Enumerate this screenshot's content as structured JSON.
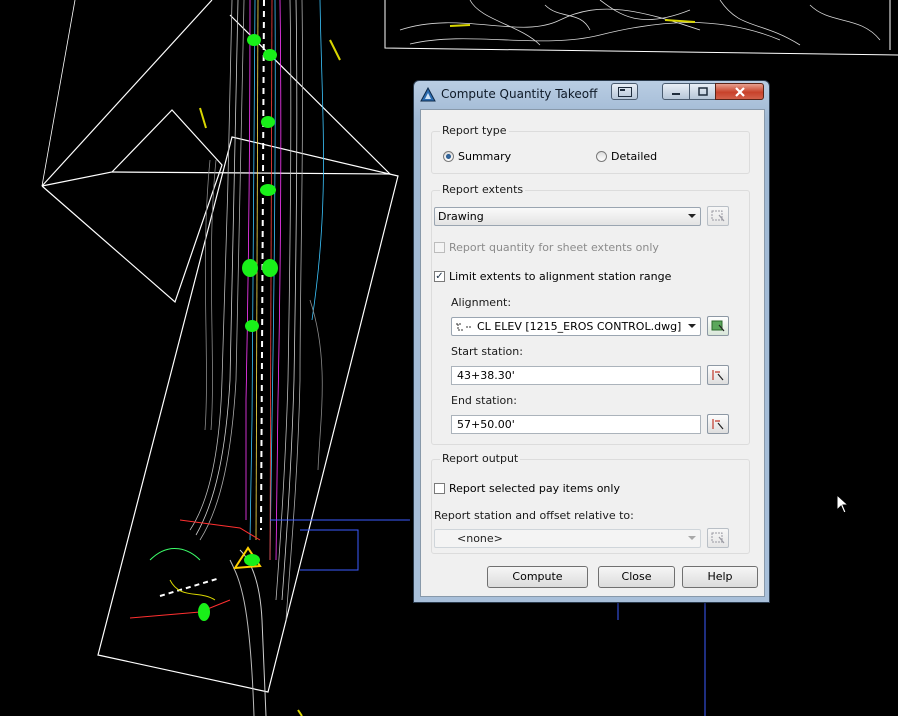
{
  "dialog": {
    "title": "Compute Quantity Takeoff",
    "report_type": {
      "label": "Report type",
      "options": [
        "Summary",
        "Detailed"
      ],
      "selected": "Summary"
    },
    "report_extents": {
      "label": "Report extents",
      "extents_value": "Drawing",
      "sheet_extents_label": "Report quantity for sheet extents only",
      "sheet_extents_checked": false,
      "limit_label": "Limit extents to alignment station range",
      "limit_checked": true,
      "alignment_label": "Alignment:",
      "alignment_value": "CL ELEV [1215_EROS CONTROL.dwg]",
      "start_label": "Start station:",
      "start_value": "43+38.30'",
      "end_label": "End station:",
      "end_value": "57+50.00'"
    },
    "report_output": {
      "label": "Report output",
      "pay_items_label": "Report selected pay items only",
      "pay_items_checked": false,
      "relative_label": "Report station and offset relative to:",
      "relative_value": "<none>"
    },
    "buttons": {
      "compute": "Compute",
      "close": "Close",
      "help": "Help"
    }
  },
  "colors": {
    "background": "#000000",
    "accent_green": "#00ff00",
    "titlebar": "#a9c0da",
    "close_button": "#c8422b"
  }
}
